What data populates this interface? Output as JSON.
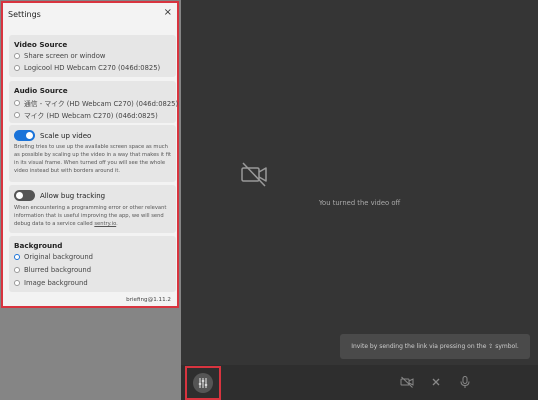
{
  "settings": {
    "title": "Settings",
    "close": "×",
    "video_source": {
      "title": "Video Source",
      "options": [
        "Share screen or window",
        "Logicool HD Webcam C270 (046d:0825)"
      ]
    },
    "audio_source": {
      "title": "Audio Source",
      "options": [
        "通信 - マイク (HD Webcam C270) (046d:0825)",
        "マイク (HD Webcam C270) (046d:0825)"
      ]
    },
    "scale_up": {
      "label": "Scale up video",
      "enabled": true,
      "description": "Briefing tries to use up the available screen space as much as possible by scaling up the video in a way that makes it fit in its visual frame. When turned off you will see the whole video instead but with borders around it."
    },
    "bug_tracking": {
      "label": "Allow bug tracking",
      "enabled": false,
      "description_prefix": "When encountering a programming error or other relevant information that is useful improving the app, we will send debug data to a service called ",
      "link": "sentry.io",
      "description_suffix": "."
    },
    "background": {
      "title": "Background",
      "options": [
        "Original background",
        "Blurred background",
        "Image background"
      ],
      "selected": "Original background"
    },
    "version": "briefing@1.11.2"
  },
  "main": {
    "video_off_text": "You turned the video off",
    "invite_text": "Invite by sending the link via pressing on the ⇪ symbol."
  },
  "toolbar": {
    "icons": [
      "settings-icon",
      "camera-off-icon",
      "hangup-icon",
      "microphone-icon"
    ]
  },
  "colors": {
    "accent": "#1a73d9",
    "highlight": "#d8343f"
  }
}
